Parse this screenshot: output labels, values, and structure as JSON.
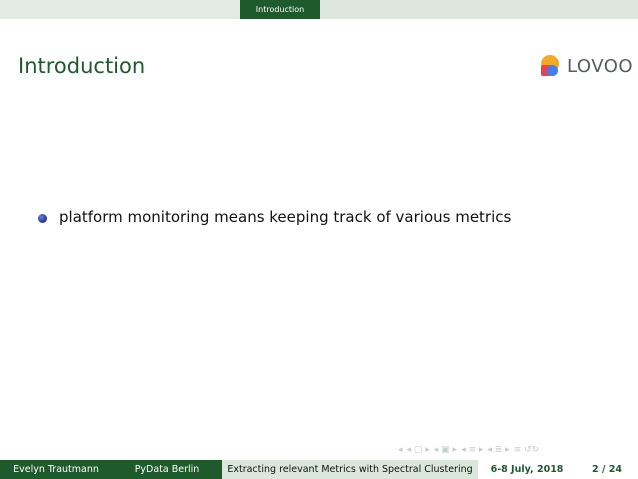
{
  "header": {
    "section": "Introduction"
  },
  "slide": {
    "title": "Introduction",
    "bullets": [
      "platform monitoring means keeping track of various metrics"
    ]
  },
  "logo": {
    "text": "LOVOO",
    "colors": [
      "#f5a623",
      "#e8434f",
      "#3f7ef0"
    ]
  },
  "nav_icons": [
    "nav-prev-icon",
    "nav-frame-icon",
    "nav-subsection-icon",
    "nav-section-icon",
    "nav-align-icon",
    "nav-search-icon"
  ],
  "footer": {
    "author": "Evelyn Trautmann",
    "event": "PyData Berlin",
    "talk": "Extracting relevant Metrics with Spectral Clustering",
    "date": "6-8 July, 2018",
    "page": "2 / 24"
  },
  "colors": {
    "accent": "#1f5a2c",
    "light": "#dce7dc"
  }
}
